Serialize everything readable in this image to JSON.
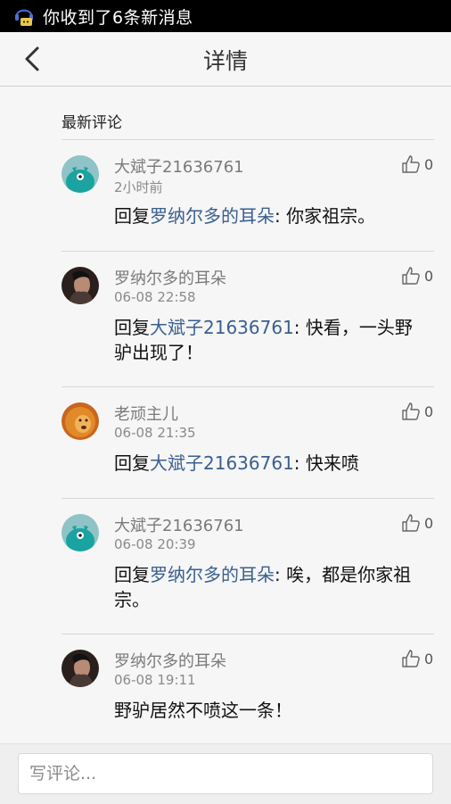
{
  "status_bar": {
    "notification": "你收到了6条新消息",
    "icon": "chat-notification-icon"
  },
  "nav": {
    "title": "详情",
    "back_icon": "chevron-left-icon"
  },
  "section": {
    "title": "最新评论"
  },
  "comments": [
    {
      "author": "大斌子21636761",
      "time": "2小时前",
      "reply_prefix": "回复",
      "mention": "罗纳尔多的耳朵",
      "text": ": 你家祖宗。",
      "likes": "0",
      "avatar": "teal-monster-avatar"
    },
    {
      "author": "罗纳尔多的耳朵",
      "time": "06-08 22:58",
      "reply_prefix": "回复",
      "mention": "大斌子21636761",
      "text": ": 快看，一头野驴出现了！",
      "likes": "0",
      "avatar": "portrait-avatar"
    },
    {
      "author": "老顽主儿",
      "time": "06-08 21:35",
      "reply_prefix": "回复",
      "mention": "大斌子21636761",
      "text": ": 快来喷",
      "likes": "0",
      "avatar": "lion-avatar"
    },
    {
      "author": "大斌子21636761",
      "time": "06-08 20:39",
      "reply_prefix": "回复",
      "mention": "罗纳尔多的耳朵",
      "text": ": 唉，都是你家祖宗。",
      "likes": "0",
      "avatar": "teal-monster-avatar"
    },
    {
      "author": "罗纳尔多的耳朵",
      "time": "06-08 19:11",
      "reply_prefix": "",
      "mention": "",
      "text": "野驴居然不喷这一条！",
      "likes": "0",
      "avatar": "portrait-avatar"
    }
  ],
  "composer": {
    "placeholder": "写评论..."
  },
  "colors": {
    "mention": "#3a5f8f",
    "author": "#7a7a7a",
    "status_bar": "#000000"
  }
}
